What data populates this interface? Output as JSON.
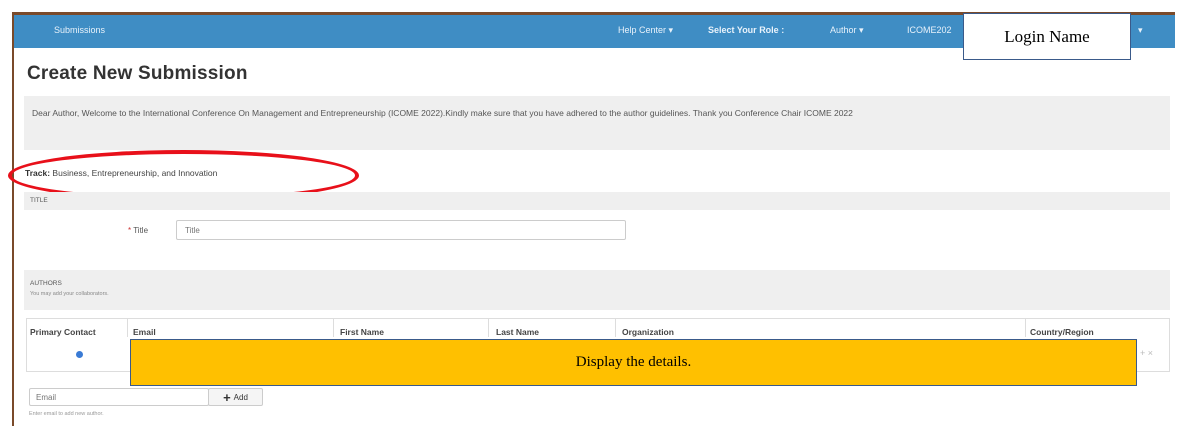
{
  "nav": {
    "submissions": "Submissions",
    "help_center": "Help Center",
    "select_role": "Select Your Role :",
    "author": "Author",
    "user": "ICOME202",
    "caret": "▾"
  },
  "annotations": {
    "login_name": "Login Name",
    "display_details": "Display the details."
  },
  "page": {
    "title": "Create New Submission",
    "welcome": "Dear Author, Welcome to the International Conference On Management and Entrepreneurship (ICOME 2022).Kindly make sure that you have adhered to the author guidelines. Thank you Conference Chair ICOME 2022",
    "track_label": "Track:",
    "track_value": "Business, Entrepreneurship, and Innovation"
  },
  "title_section": {
    "header": "TITLE",
    "required_mark": "*",
    "label": "Title",
    "placeholder": "Title"
  },
  "authors_section": {
    "header": "AUTHORS",
    "hint": "You may add your collaborators.",
    "columns": [
      "Primary Contact",
      "Email",
      "First Name",
      "Last Name",
      "Organization",
      "Country/Region"
    ],
    "row_actions": "+ ×",
    "email_placeholder": "Email",
    "add_label": "Add",
    "add_icon": "+",
    "email_hint": "Enter email to add new author."
  },
  "colors": {
    "navbar": "#3f8dc4",
    "ellipse": "#e8101a",
    "callout": "#ffc000"
  }
}
